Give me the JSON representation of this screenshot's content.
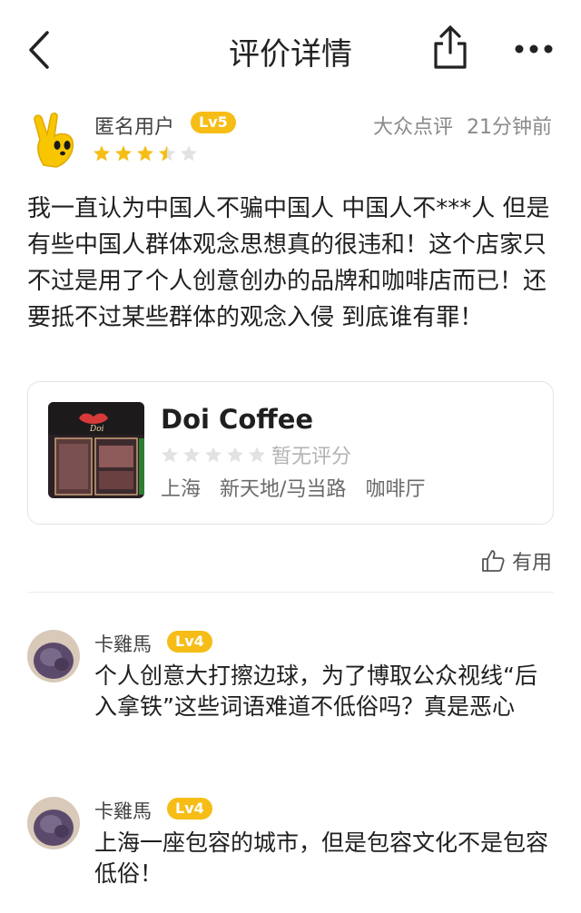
{
  "nav": {
    "title": "评价详情",
    "back_icon": "chevron-left-icon",
    "share_icon": "share-icon",
    "more_icon": "more-dots-icon"
  },
  "review": {
    "username": "匿名用户",
    "level": "Lv5",
    "rating": 3.5,
    "source": "大众点评",
    "time": "21分钟前",
    "content": "我一直认为中国人不骗中国人 中国人不***人 但是有些中国人群体观念思想真的很违和！这个店家只不过是用了个人创意创办的品牌和咖啡店而已！还要抵不过某些群体的观念入侵 到底谁有罪！"
  },
  "shop": {
    "name": "Doi Coffee",
    "rating_text": "暂无评分",
    "city": "上海",
    "area": "新天地/马当路",
    "category": "咖啡厅"
  },
  "useful_label": "有用",
  "comments": [
    {
      "name": "卡雞馬",
      "level": "Lv4",
      "text": "个人创意大打擦边球，为了博取公众视线“后入拿铁”这些词语难道不低俗吗？真是恶心"
    },
    {
      "name": "卡雞馬",
      "level": "Lv4",
      "text": "上海一座包容的城市，但是包容文化不是包容低俗！"
    }
  ],
  "colors": {
    "badge": "#f6bd16",
    "star_filled": "#f6bd16",
    "star_empty": "#e2e2e2"
  }
}
